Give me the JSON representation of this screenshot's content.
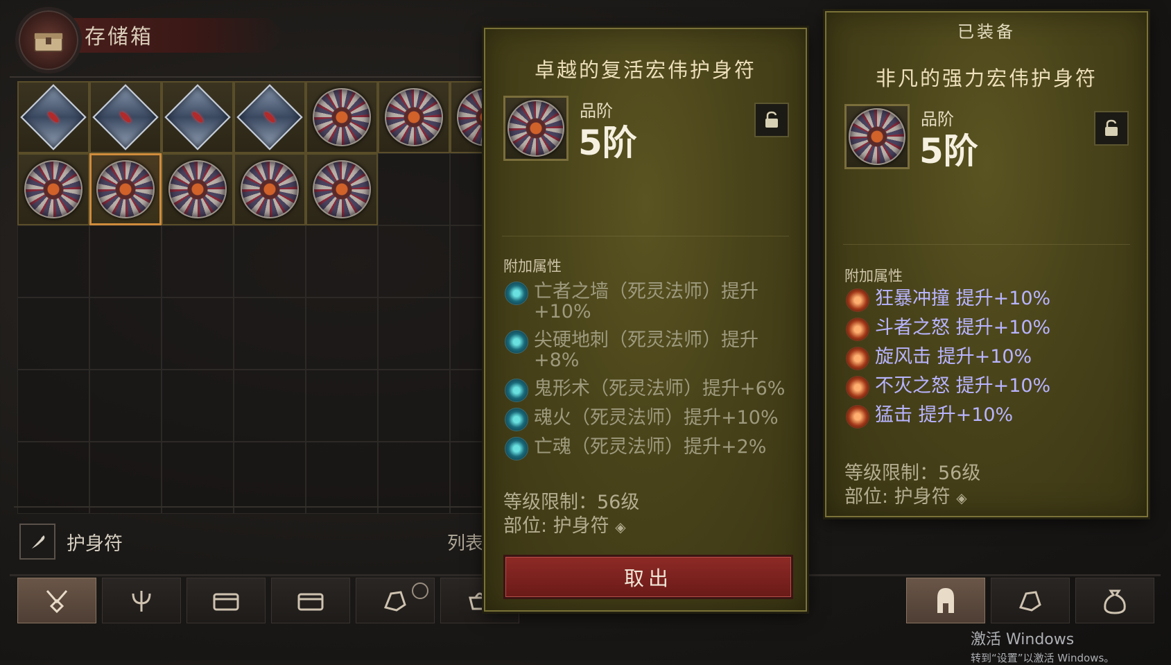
{
  "header": {
    "title": "存储箱",
    "icon": "chest-icon"
  },
  "inventory": {
    "slots": [
      {
        "type": "a"
      },
      {
        "type": "a"
      },
      {
        "type": "a"
      },
      {
        "type": "a"
      },
      {
        "type": "b"
      },
      {
        "type": "b"
      },
      {
        "type": "b"
      },
      {
        "type": "b"
      },
      {
        "type": "b",
        "selected": true
      },
      {
        "type": "b"
      },
      {
        "type": "b"
      },
      {
        "type": "b"
      },
      {
        "type": ""
      },
      {
        "type": ""
      }
    ]
  },
  "filter": {
    "label": "护身符",
    "icon": "feather-icon",
    "list_label": "列表"
  },
  "hovered_item": {
    "title": "卓越的复活宏伟护身符",
    "rank_label": "品阶",
    "rank_value": "5阶",
    "attributes_heading": "附加属性",
    "attributes": [
      {
        "text": "亡者之墙（死灵法师）提升+10%"
      },
      {
        "text": "尖硬地刺（死灵法师）提升+8%"
      },
      {
        "text": "鬼形术（死灵法师）提升+6%"
      },
      {
        "text": "魂火（死灵法师）提升+10%"
      },
      {
        "text": "亡魂（死灵法师）提升+2%"
      }
    ],
    "level_req": "等级限制：56级",
    "slot": "部位: 护身符",
    "take_button": "取出",
    "lock_icon": "unlock-icon"
  },
  "equipped_item": {
    "equipped_label": "已装备",
    "title": "非凡的强力宏伟护身符",
    "rank_label": "品阶",
    "rank_value": "5阶",
    "attributes_heading": "附加属性",
    "attributes": [
      {
        "text": "狂暴冲撞  提升+10%"
      },
      {
        "text": "斗者之怒  提升+10%"
      },
      {
        "text": "旋风击  提升+10%"
      },
      {
        "text": "不灭之怒  提升+10%"
      },
      {
        "text": "猛击  提升+10%"
      }
    ],
    "level_req": "等级限制：56级",
    "slot": "部位: 护身符",
    "lock_icon": "unlock-icon"
  },
  "tabs_left": [
    "amulet-tab-icon",
    "trident-icon",
    "chest-icon",
    "chest-icon",
    "ore-icon",
    "brazier-icon"
  ],
  "tabs_right": [
    "helmet-icon",
    "ore-icon",
    "pouch-icon"
  ],
  "watermark": {
    "line1": "激活 Windows",
    "line2": "转到“设置”以激活 Windows。"
  },
  "colors": {
    "panel": "#4d4719",
    "legendary_text": "#b8b4ff",
    "button": "#7a2420"
  }
}
